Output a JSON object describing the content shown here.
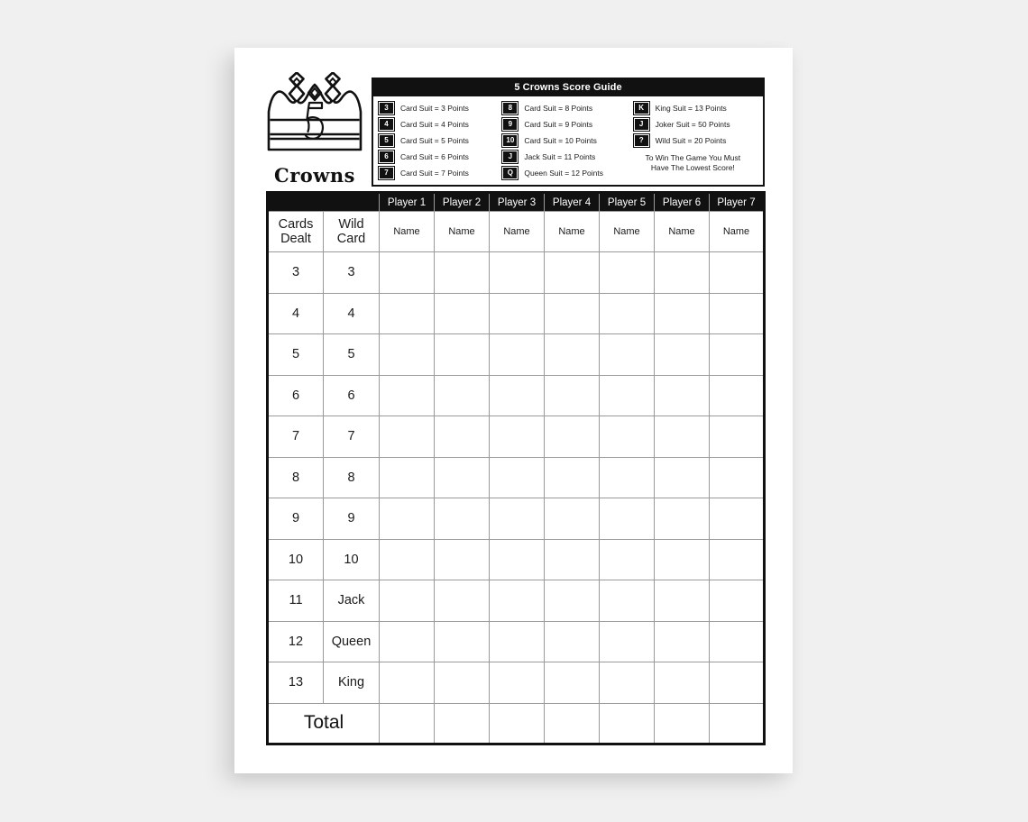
{
  "logo": {
    "number": "5",
    "wordmark": "Crowns",
    "icon": "crown-icon"
  },
  "score_guide": {
    "title": "5 Crowns Score Guide",
    "columns": [
      [
        {
          "badge": "3",
          "text": "Card Suit = 3 Points"
        },
        {
          "badge": "4",
          "text": "Card Suit = 4 Points"
        },
        {
          "badge": "5",
          "text": "Card Suit = 5 Points"
        },
        {
          "badge": "6",
          "text": "Card Suit = 6 Points"
        },
        {
          "badge": "7",
          "text": "Card Suit = 7 Points"
        }
      ],
      [
        {
          "badge": "8",
          "text": "Card Suit = 8 Points"
        },
        {
          "badge": "9",
          "text": "Card Suit = 9 Points"
        },
        {
          "badge": "10",
          "text": "Card Suit = 10 Points"
        },
        {
          "badge": "J",
          "text": "Jack Suit = 11 Points"
        },
        {
          "badge": "Q",
          "text": "Queen Suit = 12 Points"
        }
      ],
      [
        {
          "badge": "K",
          "text": "King Suit = 13 Points"
        },
        {
          "badge": "J",
          "text": "Joker Suit = 50 Points"
        },
        {
          "badge": "?",
          "text": "Wild Suit = 20 Points"
        }
      ]
    ],
    "note_line1": "To Win The Game You Must",
    "note_line2": "Have The Lowest Score!"
  },
  "table": {
    "players": [
      "Player 1",
      "Player 2",
      "Player 3",
      "Player 4",
      "Player 5",
      "Player 6",
      "Player 7"
    ],
    "name_placeholder": "Name",
    "rowhead_cards_dealt_line1": "Cards",
    "rowhead_cards_dealt_line2": "Dealt",
    "rowhead_wild_card_line1": "Wild",
    "rowhead_wild_card_line2": "Card",
    "rounds": [
      {
        "cards_dealt": "3",
        "wild_card": "3"
      },
      {
        "cards_dealt": "4",
        "wild_card": "4"
      },
      {
        "cards_dealt": "5",
        "wild_card": "5"
      },
      {
        "cards_dealt": "6",
        "wild_card": "6"
      },
      {
        "cards_dealt": "7",
        "wild_card": "7"
      },
      {
        "cards_dealt": "8",
        "wild_card": "8"
      },
      {
        "cards_dealt": "9",
        "wild_card": "9"
      },
      {
        "cards_dealt": "10",
        "wild_card": "10"
      },
      {
        "cards_dealt": "11",
        "wild_card": "Jack"
      },
      {
        "cards_dealt": "12",
        "wild_card": "Queen"
      },
      {
        "cards_dealt": "13",
        "wild_card": "King"
      }
    ],
    "total_label": "Total"
  },
  "colors": {
    "page_background": "#f0f0f0",
    "sheet": "#ffffff",
    "ink": "#111111",
    "gridline": "#9a9a9a"
  }
}
